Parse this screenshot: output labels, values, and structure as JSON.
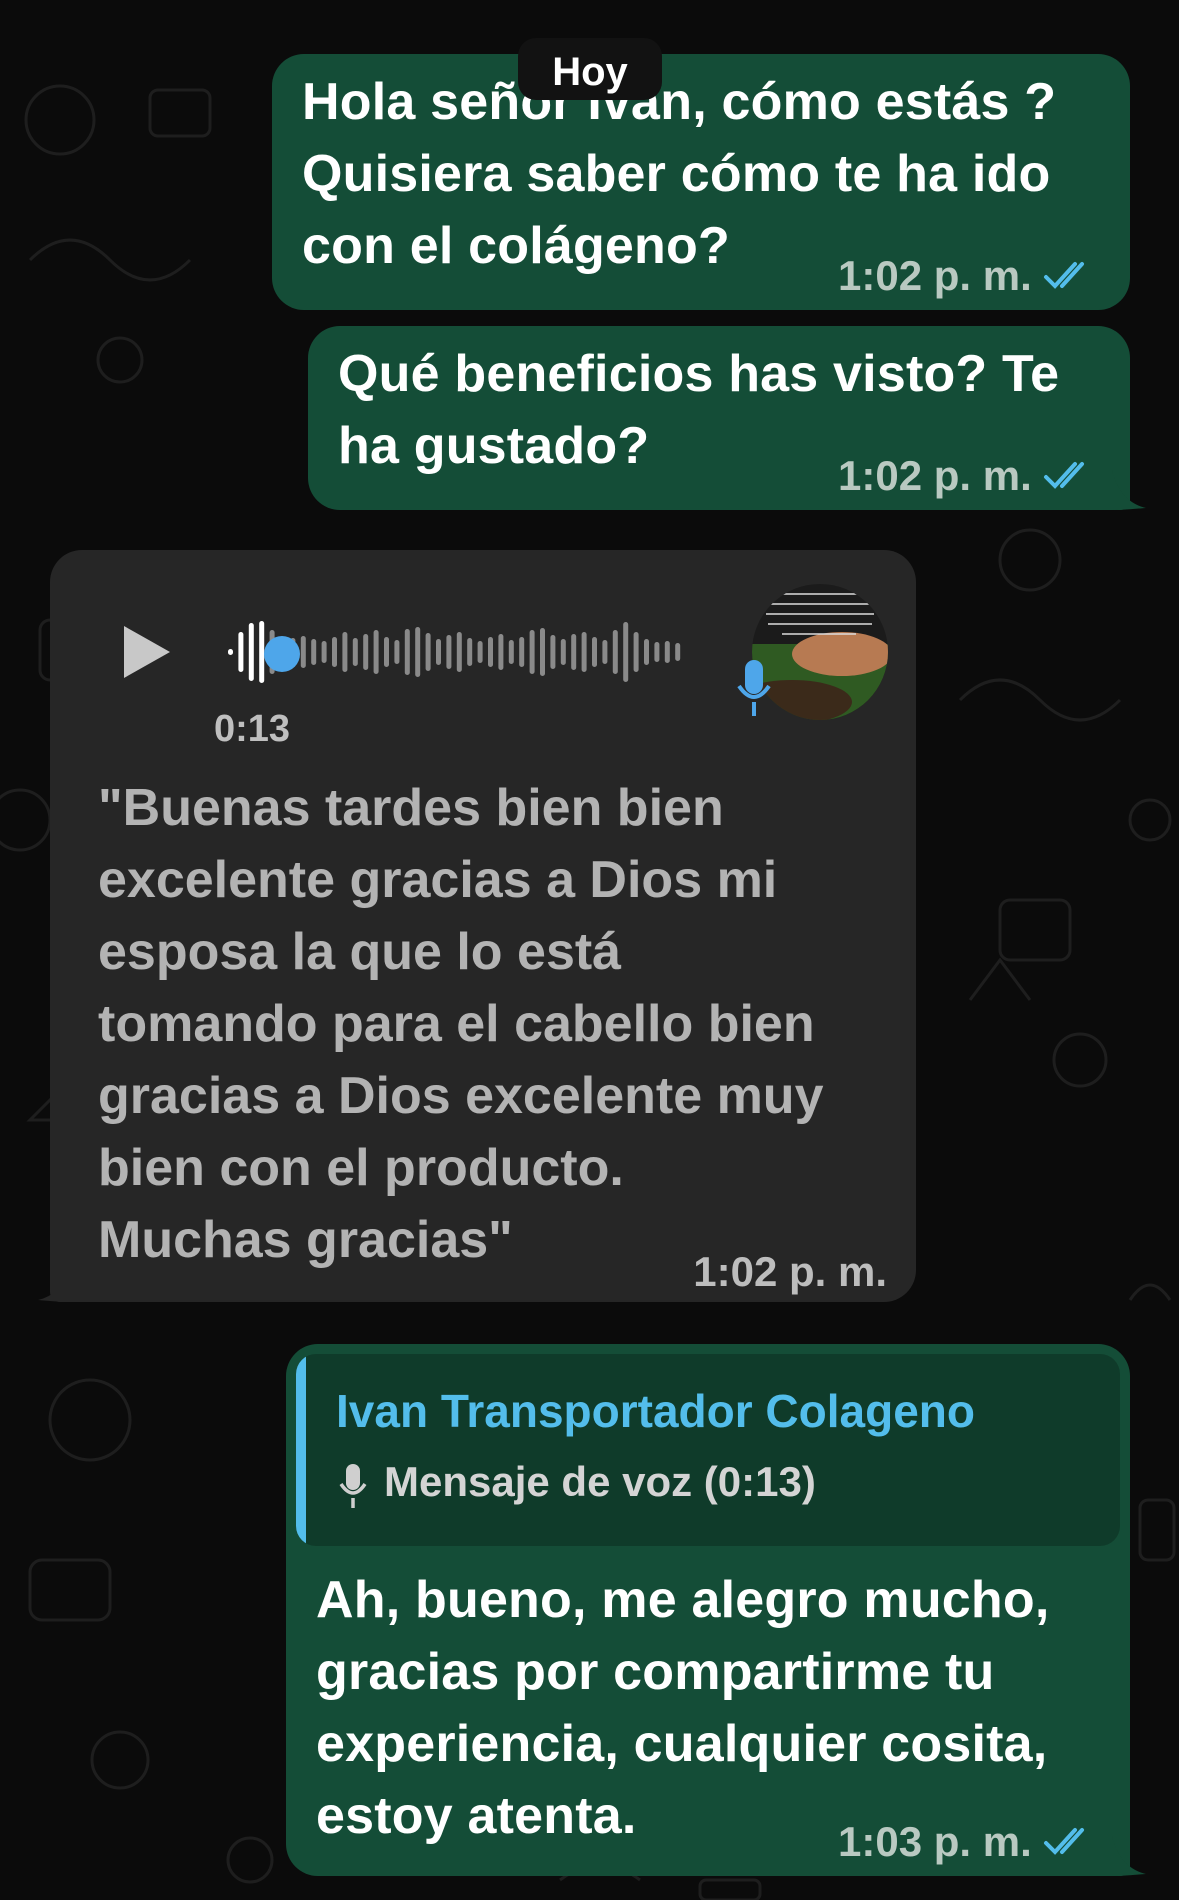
{
  "date_divider": "Hoy",
  "messages": [
    {
      "direction": "outgoing",
      "lines": [
        "Hola señor Iván, cómo estás ?",
        "Quisiera saber cómo te ha ido",
        "con el colágeno?"
      ],
      "time": "1:02 p. m.",
      "status": "read"
    },
    {
      "direction": "outgoing",
      "lines": [
        "Qué beneficios has visto? Te",
        "ha gustado?"
      ],
      "time": "1:02 p. m.",
      "status": "read"
    },
    {
      "direction": "incoming",
      "type": "voice",
      "duration": "0:13",
      "progress": 0.08,
      "transcript_lines": [
        "\"Buenas tardes bien bien",
        "excelente gracias a Dios mi",
        "esposa la que lo está",
        "tomando para el cabello bien",
        "gracias a Dios excelente muy",
        "bien con el producto.",
        "Muchas gracias\""
      ],
      "time": "1:02 p. m."
    },
    {
      "direction": "outgoing",
      "reply_to": {
        "name": "Ivan Transportador Colageno",
        "preview": "Mensaje de voz (0:13)"
      },
      "lines": [
        "Ah, bueno, me alegro mucho,",
        "gracias por compartirme tu",
        "experiencia, cualquier cosita,",
        "estoy atenta."
      ],
      "time": "1:03 p. m.",
      "status": "read"
    }
  ],
  "colors": {
    "outgoing_bubble": "#144d37",
    "incoming_bubble": "#262626",
    "accent_blue": "#53bdeb",
    "read_ticks": "#53bdeb"
  },
  "icons": [
    "play-icon",
    "microphone-icon",
    "double-check-icon"
  ]
}
